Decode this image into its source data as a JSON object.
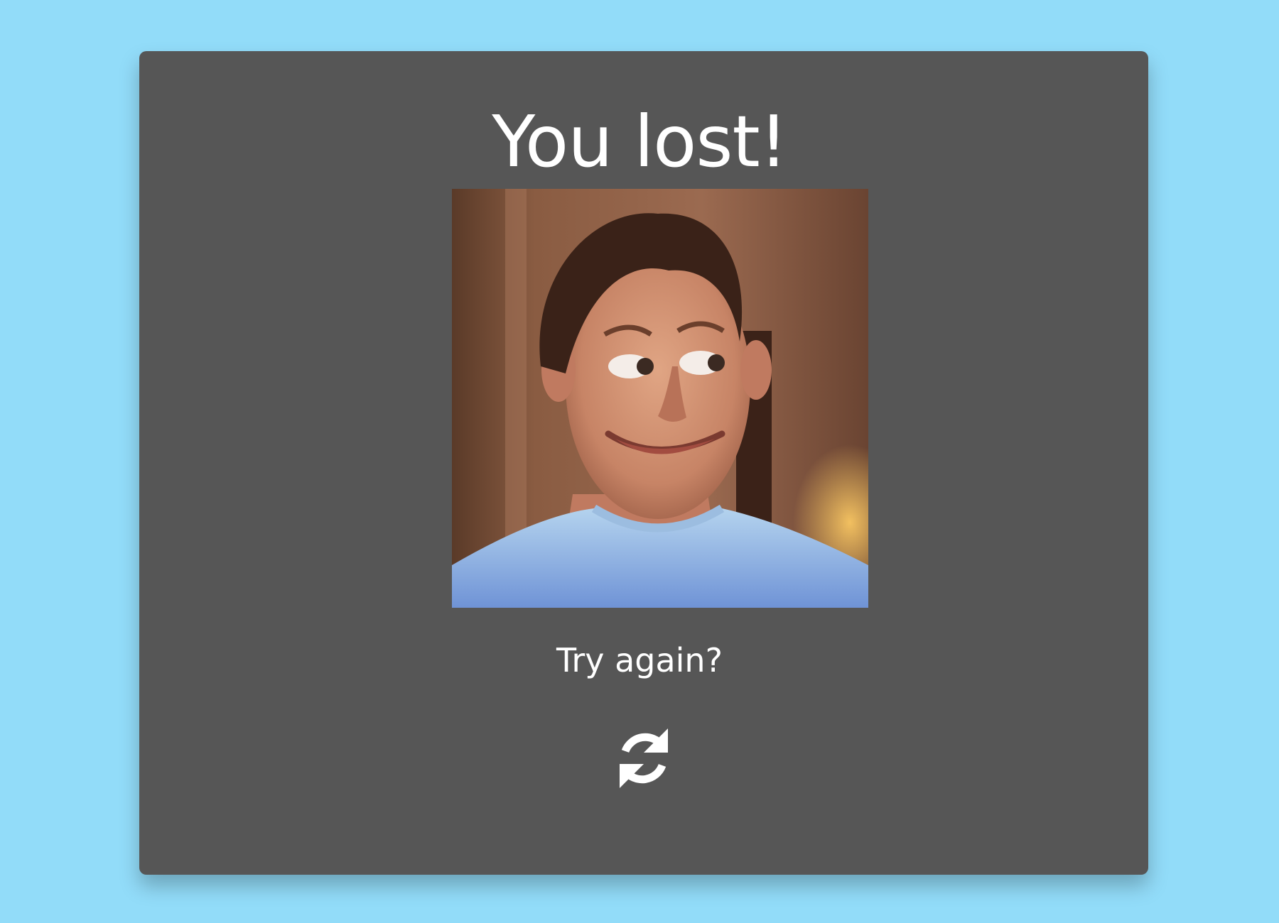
{
  "result": {
    "title": "You lost!",
    "image_subject": "man-making-a-funny-face-photo",
    "prompt": "Try again?",
    "retry_icon": "refresh-icon"
  },
  "colors": {
    "background": "#92dcf9",
    "card": "#565656",
    "text": "#ffffff"
  }
}
